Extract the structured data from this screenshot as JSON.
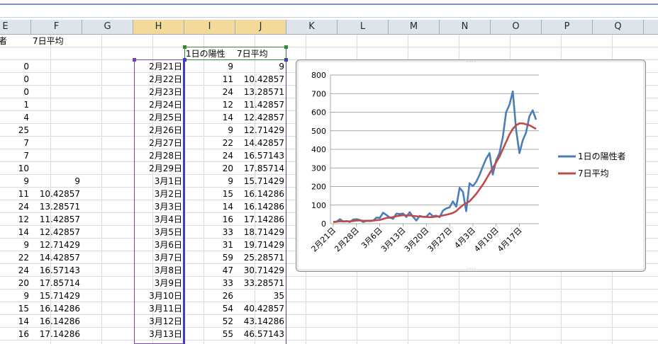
{
  "columns": [
    "E",
    "F",
    "G",
    "H",
    "I",
    "J",
    "K",
    "L",
    "M",
    "N",
    "O",
    "P",
    "Q"
  ],
  "selected_columns": [
    "H",
    "I",
    "J"
  ],
  "header_row": {
    "E": "陽性者",
    "F": "7日平均"
  },
  "table_header": {
    "I": "1日の陽性",
    "J": "7日平均"
  },
  "rows_E": [
    "0",
    "0",
    "0",
    "1",
    "4",
    "25",
    "7",
    "7",
    "10",
    "9",
    "11",
    "24",
    "12",
    "14",
    "9",
    "22",
    "24",
    "20",
    "9",
    "15",
    "14",
    "16"
  ],
  "rows_F": [
    "",
    "",
    "",
    "",
    "",
    "",
    "",
    "",
    "",
    "9",
    "10.42857",
    "13.28571",
    "11.42857",
    "12.42857",
    "12.71429",
    "14.42857",
    "16.57143",
    "17.85714",
    "15.71429",
    "16.14286",
    "16.14286",
    "17.14286"
  ],
  "rows_H": [
    "2月21日",
    "2月22日",
    "2月23日",
    "2月24日",
    "2月25日",
    "2月26日",
    "2月27日",
    "2月28日",
    "2月29日",
    "3月1日",
    "3月2日",
    "3月3日",
    "3月4日",
    "3月5日",
    "3月6日",
    "3月7日",
    "3月8日",
    "3月9日",
    "3月10日",
    "3月11日",
    "3月12日",
    "3月13日"
  ],
  "rows_I": [
    "9",
    "11",
    "24",
    "12",
    "14",
    "9",
    "22",
    "24",
    "20",
    "9",
    "15",
    "14",
    "16",
    "33",
    "31",
    "59",
    "47",
    "33",
    "26",
    "54",
    "52",
    "55"
  ],
  "rows_J": [
    "9",
    "10.42857",
    "13.28571",
    "11.42857",
    "12.42857",
    "12.71429",
    "14.42857",
    "16.57143",
    "17.85714",
    "15.71429",
    "16.14286",
    "16.14286",
    "17.14286",
    "18.71429",
    "19.71429",
    "25.28571",
    "30.71429",
    "33.28571",
    "35",
    "40.42857",
    "43.14286",
    "46.57143"
  ],
  "colors": {
    "series1": "#4a7ebb",
    "series2": "#be4b48",
    "grid_line": "#dadcdd",
    "selection": "#3f3fbf"
  },
  "chart_data": {
    "type": "line",
    "ylim": [
      0,
      800
    ],
    "yticks": [
      "0",
      "100",
      "200",
      "300",
      "400",
      "500",
      "600",
      "700",
      "800"
    ],
    "x_tick_labels": [
      "2月21日",
      "2月28日",
      "3月6日",
      "3月13日",
      "3月20日",
      "3月27日",
      "4月3日",
      "4月10日",
      "4月17日"
    ],
    "legend_position": "right",
    "series": [
      {
        "name": "1日の陽性者",
        "values": [
          9,
          11,
          24,
          12,
          14,
          9,
          22,
          24,
          20,
          9,
          15,
          14,
          16,
          33,
          31,
          59,
          47,
          33,
          26,
          54,
          52,
          55,
          36,
          62,
          37,
          17,
          42,
          37,
          38,
          56,
          40,
          43,
          35,
          70,
          82,
          88,
          120,
          91,
          193,
          171,
          67,
          218,
          202,
          225,
          262,
          308,
          350,
          380,
          264,
          340,
          380,
          464,
          600,
          640,
          712,
          505,
          380,
          448,
          490,
          578,
          610,
          560
        ],
        "color_key": "series1"
      },
      {
        "name": "7日平均",
        "values": [
          9,
          10.4,
          13.3,
          11.4,
          12.4,
          12.7,
          14.4,
          16.6,
          17.9,
          15.7,
          16.1,
          16.1,
          17.1,
          18.7,
          19.7,
          25.3,
          30.7,
          33.3,
          35,
          40.4,
          43.1,
          46.6,
          44,
          45,
          42,
          40,
          38,
          37,
          36,
          35,
          36,
          38,
          40,
          44,
          48,
          52,
          58,
          68,
          85,
          100,
          110,
          120,
          140,
          160,
          185,
          210,
          240,
          270,
          300,
          330,
          360,
          400,
          440,
          480,
          510,
          530,
          540,
          540,
          535,
          530,
          520,
          510
        ],
        "color_key": "series2"
      }
    ]
  }
}
